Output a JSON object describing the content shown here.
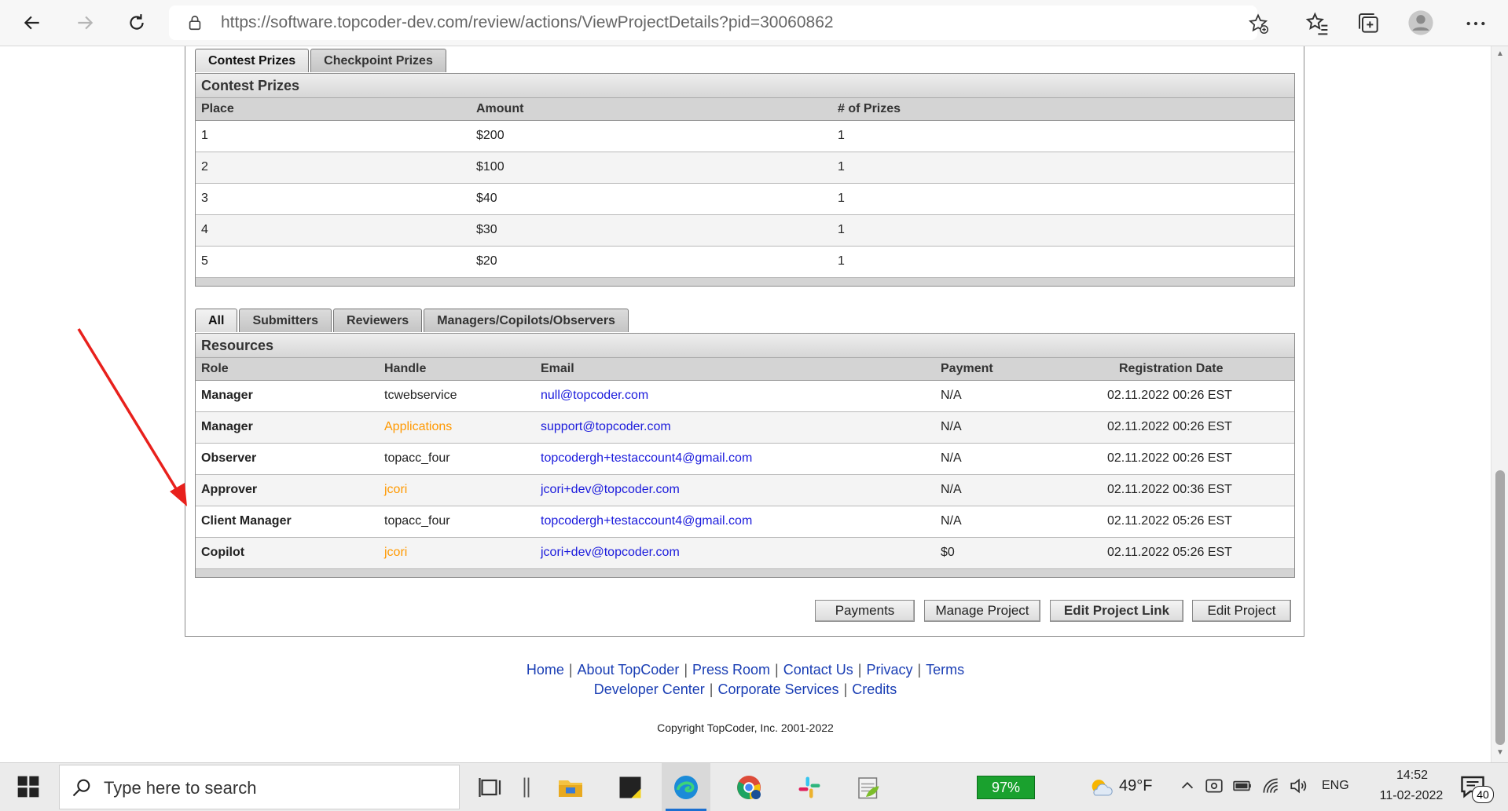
{
  "browser": {
    "url": "https://software.topcoder-dev.com/review/actions/ViewProjectDetails?pid=30060862"
  },
  "prizes": {
    "tabs": [
      {
        "label": "Contest Prizes",
        "active": true
      },
      {
        "label": "Checkpoint Prizes",
        "active": false
      }
    ],
    "title": "Contest Prizes",
    "columns": [
      "Place",
      "Amount",
      "# of Prizes"
    ],
    "rows": [
      {
        "place": "1",
        "amount": "$200",
        "count": "1"
      },
      {
        "place": "2",
        "amount": "$100",
        "count": "1"
      },
      {
        "place": "3",
        "amount": "$40",
        "count": "1"
      },
      {
        "place": "4",
        "amount": "$30",
        "count": "1"
      },
      {
        "place": "5",
        "amount": "$20",
        "count": "1"
      }
    ]
  },
  "resources": {
    "tabs": [
      {
        "label": "All",
        "active": true
      },
      {
        "label": "Submitters",
        "active": false
      },
      {
        "label": "Reviewers",
        "active": false
      },
      {
        "label": "Managers/Copilots/Observers",
        "active": false
      }
    ],
    "title": "Resources",
    "columns": [
      "Role",
      "Handle",
      "Email",
      "Payment",
      "Registration Date"
    ],
    "rows": [
      {
        "role": "Manager",
        "handle": "tcwebservice",
        "email": "null@topcoder.com",
        "payment": "N/A",
        "date": "02.11.2022 00:26 EST"
      },
      {
        "role": "Manager",
        "handle": "Applications",
        "email": "support@topcoder.com",
        "payment": "N/A",
        "date": "02.11.2022 00:26 EST"
      },
      {
        "role": "Observer",
        "handle": "topacc_four",
        "email": "topcodergh+testaccount4@gmail.com",
        "payment": "N/A",
        "date": "02.11.2022 00:26 EST"
      },
      {
        "role": "Approver",
        "handle": "jcori",
        "email": "jcori+dev@topcoder.com",
        "payment": "N/A",
        "date": "02.11.2022 00:36 EST"
      },
      {
        "role": "Client Manager",
        "handle": "topacc_four",
        "email": "topcodergh+testaccount4@gmail.com",
        "payment": "N/A",
        "date": "02.11.2022 05:26 EST"
      },
      {
        "role": "Copilot",
        "handle": "jcori",
        "email": "jcori+dev@topcoder.com",
        "payment": "$0",
        "date": "02.11.2022 05:26 EST"
      }
    ]
  },
  "actions": {
    "payments": "Payments",
    "manage_project": "Manage Project",
    "edit_project_link": "Edit Project Link",
    "edit_project": "Edit Project"
  },
  "footer": {
    "links_line1": [
      "Home",
      "About TopCoder",
      "Press Room",
      "Contact Us",
      "Privacy",
      "Terms"
    ],
    "links_line2": [
      "Developer Center",
      "Corporate Services",
      "Credits"
    ],
    "copyright": "Copyright TopCoder, Inc. 2001-2022"
  },
  "taskbar": {
    "search_placeholder": "Type here to search",
    "battery": "97%",
    "temperature": "49°F",
    "language": "ENG",
    "time": "14:52",
    "date": "11-02-2022",
    "notifications": "40"
  },
  "colors": {
    "link": "#1a1adc",
    "handle_highlight": "#ff9900",
    "annotation_arrow": "#e8201c"
  }
}
